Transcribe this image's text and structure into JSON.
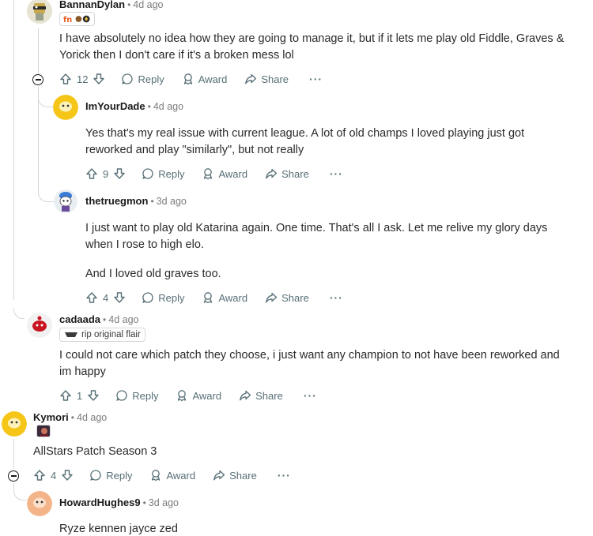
{
  "comments": [
    {
      "username": "BannanDylan",
      "time": "4d ago",
      "text": "I have absolutely no idea how they are going to manage it, but if it lets me play old Fiddle, Graves & Yorick then I don't care if it's a broken mess lol",
      "votes": "12",
      "flair": ""
    },
    {
      "username": "ImYourDade",
      "time": "4d ago",
      "text": "Yes that's my real issue with current league. A lot of old champs I loved playing just got reworked and play \"similarly\", but not really",
      "votes": "9"
    },
    {
      "username": "thetruegmon",
      "time": "3d ago",
      "text": "I just want to play old Katarina again. One time. That's all I ask. Let me relive my glory days when I rose to high elo.",
      "text2": "And I loved old graves too.",
      "votes": "4"
    },
    {
      "username": "cadaada",
      "time": "4d ago",
      "flair": "rip original flair",
      "text": "I could not care which patch they choose, i just want any champion to not have been reworked and im happy",
      "votes": "1"
    },
    {
      "username": "Kymori",
      "time": "4d ago",
      "text": "AllStars Patch Season 3",
      "votes": "4"
    },
    {
      "username": "HowardHughes9",
      "time": "3d ago",
      "text": "Ryze kennen jayce zed"
    }
  ],
  "labels": {
    "reply": "Reply",
    "award": "Award",
    "share": "Share",
    "more": "···",
    "separator": "•"
  },
  "colors": {
    "meta_gray": "#7c7c7c",
    "action_gray": "#576f76",
    "thread_line": "#d4d7d9",
    "avatar_yellow": "#f5c518",
    "avatar_peach": "#f3b48a"
  }
}
